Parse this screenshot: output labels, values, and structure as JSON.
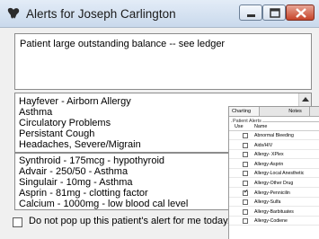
{
  "window": {
    "title": "Alerts for Joseph Carlington"
  },
  "note": {
    "text": "Patient large outstanding balance -- see ledger"
  },
  "conditions": [
    "Hayfever - Airborn Allergy",
    "Asthma",
    "Circulatory Problems",
    "Persistant Cough",
    "Headaches, Severe/Migrain"
  ],
  "medications": [
    "Synthroid - 175mcg - hypothyroid",
    "Advair - 250/50 - Asthma",
    "Singulair - 10mg - Asthma",
    "Asprin - 81mg - clotting factor",
    "Calcium - 1000mg - low blood cal level"
  ],
  "footer": {
    "checkbox_label": "Do not pop up this patient's alert for me today.",
    "checked": false
  },
  "inset": {
    "tabs": [
      "Charting",
      "Notes"
    ],
    "group_label": "Patient Alerts",
    "columns": [
      "Use",
      "Name"
    ],
    "alerts": [
      {
        "name": "Abnormal Bleeding",
        "checked": false
      },
      {
        "name": "Aids/HIV",
        "checked": false
      },
      {
        "name": "Allergy- XPlex",
        "checked": false
      },
      {
        "name": "Allergy-Asprin",
        "checked": false
      },
      {
        "name": "Allergy-Local Anesthetic",
        "checked": false
      },
      {
        "name": "Allergy-Other Drug",
        "checked": false
      },
      {
        "name": "Allergy-Pennicilin",
        "checked": true
      },
      {
        "name": "Allergy-Sulfa",
        "checked": false
      },
      {
        "name": "Allergy-Barbituates",
        "checked": false
      },
      {
        "name": "Allergy-Codiene",
        "checked": false
      }
    ]
  }
}
